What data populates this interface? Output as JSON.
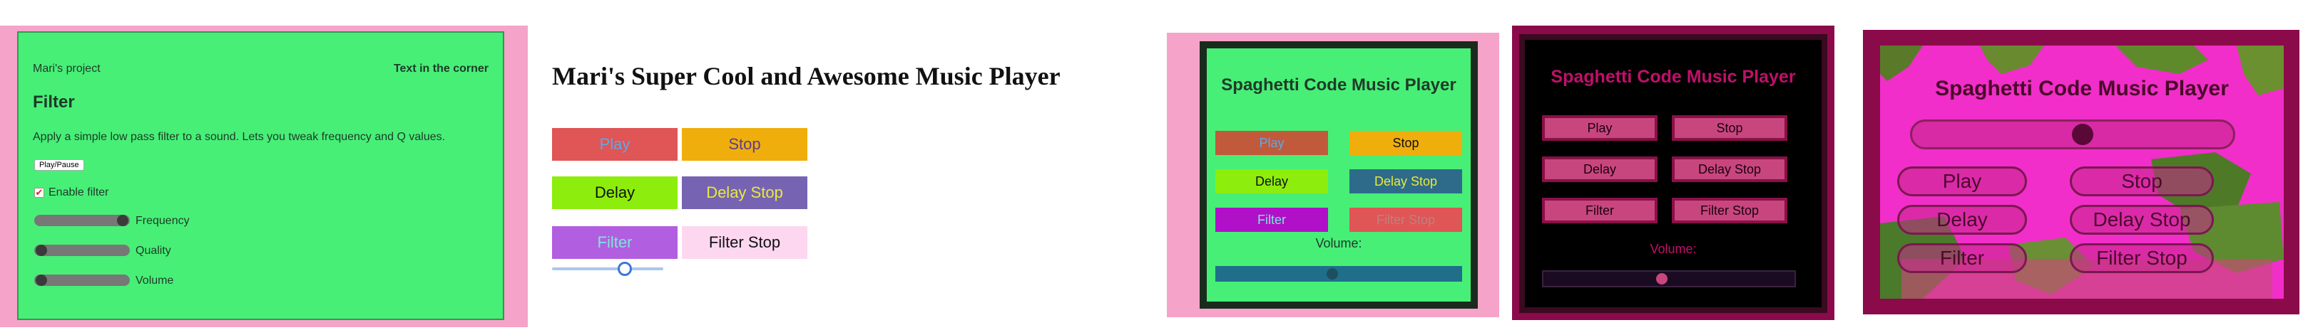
{
  "panel1": {
    "project": "Mari's project",
    "corner": "Text in the corner",
    "title": "Filter",
    "description": "Apply a simple low pass filter to a sound. Lets you tweak frequency and Q values.",
    "play_pause": "Play/Pause",
    "enable_filter": "Enable filter",
    "frequency": "Frequency",
    "quality": "Quality",
    "volume": "Volume",
    "checkbox_checked": true
  },
  "panel2": {
    "heading": "Mari's Super Cool and Awesome Music Player",
    "buttons": {
      "play": "Play",
      "stop": "Stop",
      "delay": "Delay",
      "delay_stop": "Delay Stop",
      "filter": "Filter",
      "filter_stop": "Filter Stop"
    },
    "slider_value": 0.65
  },
  "panel3": {
    "heading": "Spaghetti Code Music Player",
    "buttons": {
      "play": "Play",
      "stop": "Stop",
      "delay": "Delay",
      "delay_stop": "Delay Stop",
      "filter": "Filter",
      "filter_stop": "Filter Stop"
    },
    "volume_label": "Volume:",
    "volume_value": 0.5
  },
  "panel4": {
    "heading": "Spaghetti Code Music Player",
    "buttons": {
      "play": "Play",
      "stop": "Stop",
      "delay": "Delay",
      "delay_stop": "Delay Stop",
      "filter": "Filter",
      "filter_stop": "Filter Stop"
    },
    "volume_label": "Volume:",
    "volume_value": 0.5
  },
  "panel5": {
    "heading": "Spaghetti Code Music Player",
    "buttons": {
      "play": "Play",
      "stop": "Stop",
      "delay": "Delay",
      "delay_stop": "Delay Stop",
      "filter": "Filter",
      "filter_stop": "Filter Stop"
    },
    "volume_value": 0.5
  },
  "colors": {
    "green": "#47ef77",
    "pink": "#f5a3c9",
    "maroon": "#8a0a4a",
    "magenta": "#f12ec9"
  }
}
